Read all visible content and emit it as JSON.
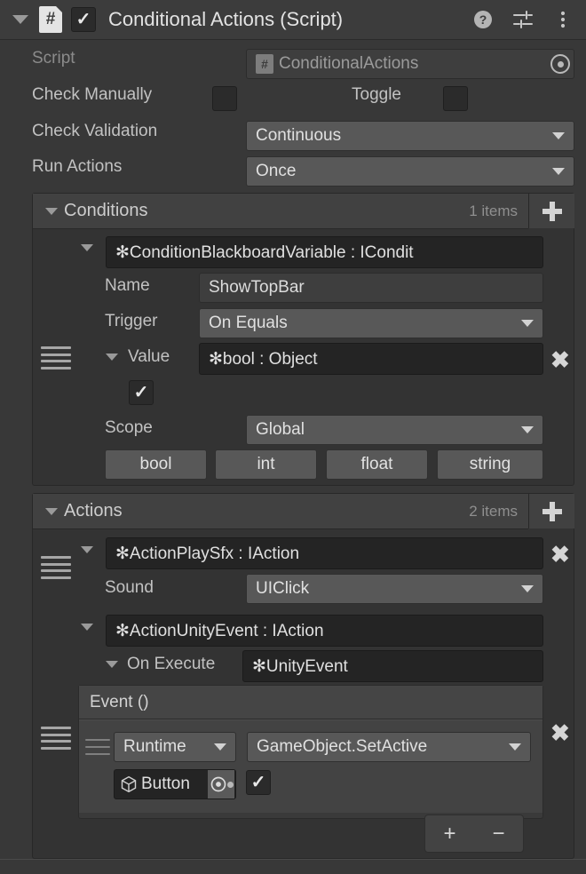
{
  "component": {
    "title": "Conditional Actions (Script)",
    "script_badge": "#",
    "enabled": true,
    "icons": {
      "help": "help-icon",
      "preset": "preset-slider-icon",
      "menu": "kebab-menu-icon"
    }
  },
  "fields": {
    "script_label": "Script",
    "script_value": "ConditionalActions",
    "check_manually_label": "Check Manually",
    "check_manually_value": false,
    "toggle_label": "Toggle",
    "toggle_value": false,
    "check_validation_label": "Check Validation",
    "check_validation_value": "Continuous",
    "run_actions_label": "Run Actions",
    "run_actions_value": "Once"
  },
  "conditions": {
    "header": "Conditions",
    "count": "1 items",
    "add_label": "+",
    "item": {
      "type": "✻ConditionBlackboardVariable : ICondit",
      "name_label": "Name",
      "name_value": "ShowTopBar",
      "trigger_label": "Trigger",
      "trigger_value": "On Equals",
      "value_label": "Value",
      "value_type": "✻bool : Object",
      "value_bool": true,
      "scope_label": "Scope",
      "scope_value": "Global",
      "type_buttons": [
        "bool",
        "int",
        "float",
        "string"
      ],
      "remove_label": "✖"
    }
  },
  "actions": {
    "header": "Actions",
    "count": "2 items",
    "add_label": "+",
    "item1": {
      "type": "✻ActionPlaySfx : IAction",
      "sound_label": "Sound",
      "sound_value": "UIClick",
      "remove_label": "✖"
    },
    "item2": {
      "type": "✻ActionUnityEvent : IAction",
      "on_execute_label": "On Execute",
      "on_execute_value": "✻UnityEvent",
      "event_title": "Event ()",
      "call_mode": "Runtime ",
      "call_method": "GameObject.SetActive",
      "call_target": "Button",
      "call_arg_bool": true,
      "add_call_label": "+",
      "remove_call_label": "−",
      "remove_label": "✖"
    }
  }
}
